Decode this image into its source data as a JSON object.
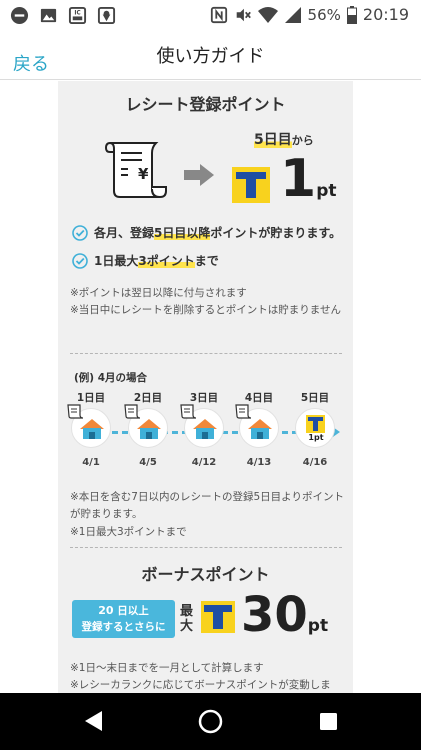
{
  "statusbar": {
    "battery": "56%",
    "time": "20:19",
    "icons": [
      "minus-circle-icon",
      "image-icon",
      "cc-card-icon",
      "map-pin-icon",
      "nfc-icon",
      "mute-icon",
      "wifi-icon",
      "signal-icon",
      "battery-icon"
    ]
  },
  "header": {
    "back_label": "戻る",
    "title": "使い方ガイド"
  },
  "receipt_section": {
    "title": "レシート登録ポイント",
    "from_day": "5日目",
    "from_suffix": "から",
    "point_value": "1",
    "point_unit": "pt",
    "check1_pre": "各月、登録",
    "check1_hl": "5日目以降",
    "check1_post": "ポイントが貯まります。",
    "check2_pre": "1日最大",
    "check2_hl": "3ポイント",
    "check2_post": "まで",
    "note1": "※ポイントは翌日以降に付与されます",
    "note2": "※当日中にレシートを削除するとポイントは貯まりません"
  },
  "example": {
    "label": "(例) 4月の場合",
    "days": [
      {
        "label": "1日目",
        "date": "4/1"
      },
      {
        "label": "2日目",
        "date": "4/5"
      },
      {
        "label": "3日目",
        "date": "4/12"
      },
      {
        "label": "4日目",
        "date": "4/13"
      },
      {
        "label": "5日目",
        "date": "4/16"
      }
    ],
    "fifth_point": "1",
    "fifth_unit": "pt",
    "note1": "※本日を含む7日以内のレシートの登録5日目よりポイントが貯まります。",
    "note2": "※1日最大3ポイントまで"
  },
  "bonus_section": {
    "title": "ボーナスポイント",
    "pill_line1_num": "20",
    "pill_line1_text": "日以上",
    "pill_line2": "登録するとさらに",
    "max_label": "最大",
    "point_value": "30",
    "point_unit": "pt",
    "note1": "※1日〜末日までを一月として計算します",
    "note2": "※レシーカランクに応じてボーナスポイントが変動しま"
  },
  "colors": {
    "accent": "#2aa5c7",
    "tpoint_blue": "#1f4ea3",
    "tpoint_yellow": "#f8d21e",
    "highlight": "#ffe44d",
    "check": "#3fb0d8"
  }
}
